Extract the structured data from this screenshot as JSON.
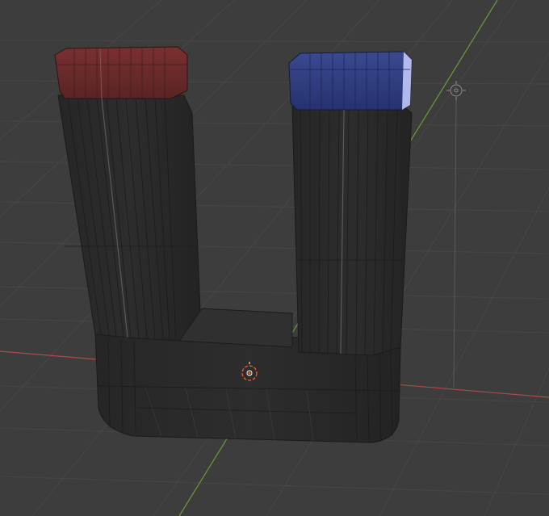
{
  "viewport": {
    "background": "#3d3d3d",
    "grid_color": "#4a4a4a",
    "axis_x_color": "#b04a4a",
    "axis_y_color": "#6a9a3a",
    "mesh_body_color": "#2b2b2b",
    "mesh_wire_color": "#1a1a1a",
    "north_pole_color": "#6b2a2a",
    "south_pole_color": "#2e3a7a",
    "origin_marker_color": "#ff5a1e",
    "camera_target_color": "#9a9a9a"
  },
  "scene": {
    "object_name": "horseshoe-magnet",
    "poles": [
      {
        "name": "north-pole",
        "color": "#6b2a2a"
      },
      {
        "name": "south-pole",
        "color": "#2e3a7a"
      }
    ]
  }
}
